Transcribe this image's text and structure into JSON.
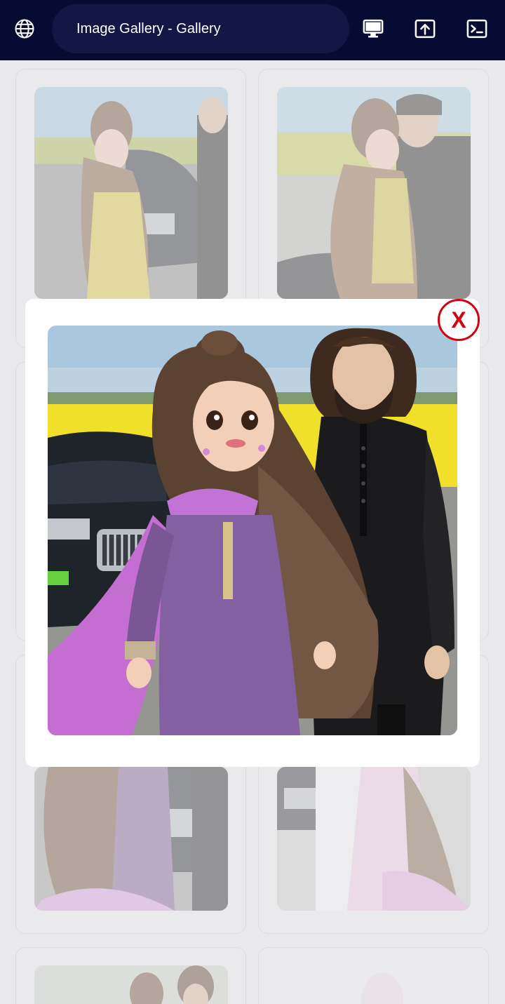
{
  "header": {
    "title": "Image Gallery - Gallery",
    "icons": [
      "globe-icon",
      "desktop-icon",
      "upload-icon",
      "terminal-icon"
    ]
  },
  "modal": {
    "close_label": "X"
  },
  "colors": {
    "topbar": "#070a33",
    "title_pill": "#141745",
    "close_accent": "#d40010"
  }
}
